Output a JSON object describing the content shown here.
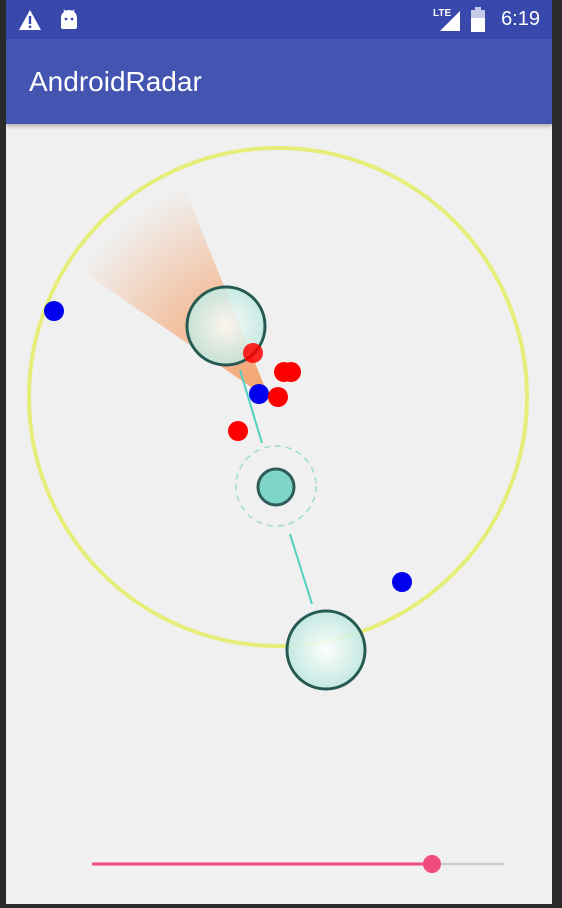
{
  "status_bar": {
    "time": "6:19",
    "network_label": "LTE",
    "icons": [
      "warning-icon",
      "android-icon",
      "signal-icon",
      "battery-icon"
    ]
  },
  "app_bar": {
    "title": "AndroidRadar"
  },
  "radar": {
    "ring_color": "#e6ee7a",
    "sweep_color": "#f4a06a",
    "node_fill": "#cdeee6",
    "node_stroke": "#245a52",
    "link_color": "#4fd2c0",
    "center_fill": "#7dd6c8",
    "blip_colors": {
      "red": "#ff0000",
      "blue": "#0000ee"
    }
  },
  "slider": {
    "value_fraction": 0.835,
    "active_color": "#ee4b7a",
    "track_color": "#cccccc"
  }
}
